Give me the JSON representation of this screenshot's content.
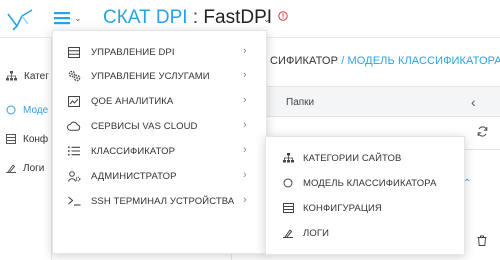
{
  "header": {
    "brand": "СКАТ DPI",
    "separator": ":",
    "device": "FastDPI"
  },
  "sidebar": {
    "items": [
      {
        "label": "Катег",
        "icon": "sitemap-icon"
      },
      {
        "label": "Моде",
        "icon": "circle-icon"
      },
      {
        "label": "Конф",
        "icon": "server-icon"
      },
      {
        "label": "Логи",
        "icon": "logs-icon"
      }
    ]
  },
  "breadcrumb": {
    "parent": "СИФИКАТОР",
    "separator": "/",
    "current": "МОДЕЛЬ КЛАССИФИКАТОРА"
  },
  "folders": {
    "title": "Папки",
    "collapse": "‹",
    "count_fragment": ")",
    "expand": "⌃"
  },
  "menu": {
    "items": [
      {
        "label": "УПРАВЛЕНИЕ DPI",
        "icon": "server-icon",
        "arrow": "›"
      },
      {
        "label": "УПРАВЛЕНИЕ УСЛУГАМИ",
        "icon": "gears-icon",
        "arrow": "›"
      },
      {
        "label": "QOE АНАЛИТИКА",
        "icon": "chart-icon",
        "arrow": "›"
      },
      {
        "label": "СЕРВИСЫ VAS CLOUD",
        "icon": "cloud-icon",
        "arrow": "›"
      },
      {
        "label": "КЛАССИФИКАТОР",
        "icon": "list-icon",
        "arrow": "›"
      },
      {
        "label": "АДМИНИСТРАТОР",
        "icon": "user-gear-icon",
        "arrow": "›"
      },
      {
        "label": "SSH ТЕРМИНАЛ УСТРОЙСТВА",
        "icon": "terminal-icon",
        "arrow": "›"
      }
    ]
  },
  "submenu": {
    "items": [
      {
        "label": "КАТЕГОРИИ САЙТОВ",
        "icon": "sitemap-icon"
      },
      {
        "label": "МОДЕЛЬ КЛАССИФИКАТОРА",
        "icon": "circle-icon"
      },
      {
        "label": "КОНФИГУРАЦИЯ",
        "icon": "server-icon"
      },
      {
        "label": "ЛОГИ",
        "icon": "logs-icon"
      }
    ]
  },
  "colors": {
    "accent": "#2aa3e6",
    "alert": "#e23b3b",
    "text": "#333333"
  }
}
